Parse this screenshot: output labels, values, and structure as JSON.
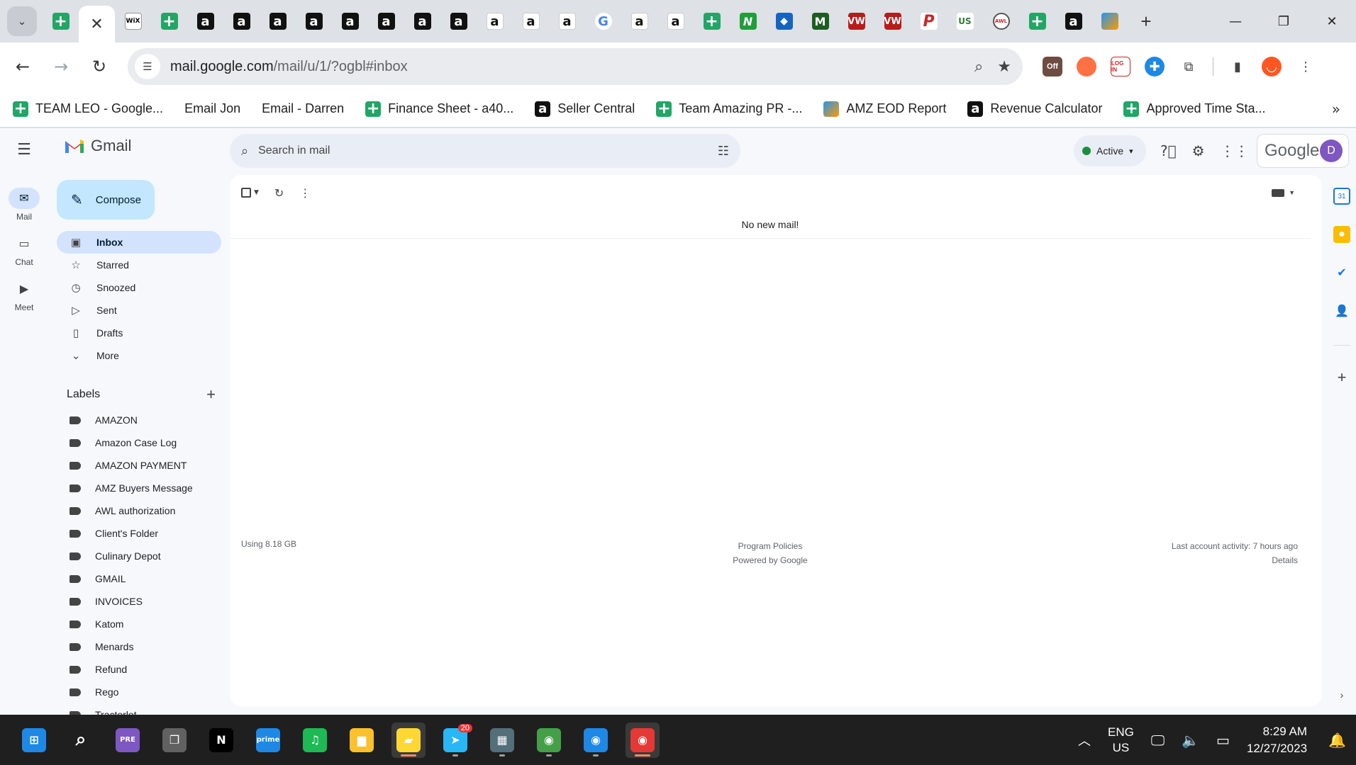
{
  "browser": {
    "tabs": [
      {
        "icon": "sheets-icon",
        "glyph": "+"
      },
      {
        "icon": "close-icon",
        "glyph": "✕",
        "active": true
      },
      {
        "icon": "wix-icon",
        "glyph": "WiX"
      },
      {
        "icon": "sheets-icon",
        "glyph": "+"
      },
      {
        "icon": "amazon-icon",
        "glyph": "a"
      },
      {
        "icon": "amazon-icon",
        "glyph": "a"
      },
      {
        "icon": "amazon-icon",
        "glyph": "a"
      },
      {
        "icon": "amazon-icon",
        "glyph": "a"
      },
      {
        "icon": "amazon-icon",
        "glyph": "a"
      },
      {
        "icon": "amazon-icon",
        "glyph": "a"
      },
      {
        "icon": "amazon-icon",
        "glyph": "a"
      },
      {
        "icon": "amazon-icon",
        "glyph": "a"
      },
      {
        "icon": "amazon-white-icon",
        "glyph": "a"
      },
      {
        "icon": "amazon-white-icon",
        "glyph": "a"
      },
      {
        "icon": "amazon-white-icon",
        "glyph": "a"
      },
      {
        "icon": "google-icon",
        "glyph": "G"
      },
      {
        "icon": "amazon-white-icon",
        "glyph": "a"
      },
      {
        "icon": "amazon-white-icon",
        "glyph": "a"
      },
      {
        "icon": "sheets-icon",
        "glyph": "+"
      },
      {
        "icon": "n-icon",
        "glyph": "N"
      },
      {
        "icon": "diamond-icon",
        "glyph": "◆"
      },
      {
        "icon": "m-icon",
        "glyph": "M"
      },
      {
        "icon": "vw-icon",
        "glyph": "VW"
      },
      {
        "icon": "vw-icon",
        "glyph": "VW"
      },
      {
        "icon": "p-icon",
        "glyph": "P"
      },
      {
        "icon": "usfoods-icon",
        "glyph": "US"
      },
      {
        "icon": "awl-icon",
        "glyph": "AWL"
      },
      {
        "icon": "sheets-icon",
        "glyph": "+"
      },
      {
        "icon": "amazon-icon",
        "glyph": "a"
      },
      {
        "icon": "pen-icon",
        "glyph": ""
      }
    ],
    "url_host": "mail.google.com",
    "url_path": "/mail/u/1/?ogbl#inbox",
    "bookmarks": [
      {
        "icon": "sheets",
        "label": "TEAM LEO - Google..."
      },
      {
        "icon": "gmail",
        "label": "Email Jon"
      },
      {
        "icon": "gmail",
        "label": "Email - Darren"
      },
      {
        "icon": "sheets",
        "label": "Finance Sheet - a40..."
      },
      {
        "icon": "amazon",
        "label": "Seller Central"
      },
      {
        "icon": "sheets",
        "label": "Team Amazing PR -..."
      },
      {
        "icon": "pen",
        "label": "AMZ EOD Report"
      },
      {
        "icon": "amazon",
        "label": "Revenue Calculator"
      },
      {
        "icon": "sheets",
        "label": "Approved Time Sta..."
      }
    ]
  },
  "gmail": {
    "logo_text": "Gmail",
    "rail": [
      {
        "label": "Mail",
        "icon": "mail-icon",
        "glyph": "✉",
        "active": true
      },
      {
        "label": "Chat",
        "icon": "chat-icon",
        "glyph": "▭"
      },
      {
        "label": "Meet",
        "icon": "meet-icon",
        "glyph": "▶"
      }
    ],
    "compose_label": "Compose",
    "nav": [
      {
        "label": "Inbox",
        "icon": "inbox-icon",
        "glyph": "▣",
        "active": true
      },
      {
        "label": "Starred",
        "icon": "star-icon",
        "glyph": "☆"
      },
      {
        "label": "Snoozed",
        "icon": "clock-icon",
        "glyph": "◷"
      },
      {
        "label": "Sent",
        "icon": "send-icon",
        "glyph": "▷"
      },
      {
        "label": "Drafts",
        "icon": "draft-icon",
        "glyph": "▯"
      },
      {
        "label": "More",
        "icon": "chevron-down-icon",
        "glyph": "⌄"
      }
    ],
    "labels_title": "Labels",
    "labels": [
      "AMAZON",
      "Amazon Case Log",
      "AMAZON PAYMENT",
      "AMZ Buyers Message",
      "AWL authorization",
      "Client's Folder",
      "Culinary Depot",
      "GMAIL",
      "INVOICES",
      "Katom",
      "Menards",
      "Refund",
      "Rego",
      "Tractorlot"
    ],
    "search_placeholder": "Search in mail",
    "status_label": "Active",
    "google_word": "Google",
    "avatar_letter": "D",
    "empty_message": "No new mail!",
    "storage": "Using 8.18 GB",
    "program_policies": "Program Policies",
    "powered_by": "Powered by Google",
    "last_activity": "Last account activity: 7 hours ago",
    "details": "Details"
  },
  "taskbar": {
    "apps": [
      {
        "name": "start-button",
        "glyph": "⊞",
        "bg": "#1e88e5"
      },
      {
        "name": "search-icon",
        "glyph": "⌕",
        "bg": "transparent"
      },
      {
        "name": "copilot-icon",
        "glyph": "PRE",
        "bg": "#7e57c2"
      },
      {
        "name": "task-view-icon",
        "glyph": "❐",
        "bg": "#616161"
      },
      {
        "name": "netflix-icon",
        "glyph": "N",
        "bg": "#000000"
      },
      {
        "name": "prime-video-icon",
        "glyph": "prime",
        "bg": "#1e88e5"
      },
      {
        "name": "spotify-icon",
        "glyph": "♫",
        "bg": "#1db954"
      },
      {
        "name": "file-explorer-icon",
        "glyph": "▆",
        "bg": "#fbc02d"
      },
      {
        "name": "sticky-notes-icon",
        "glyph": "▰",
        "bg": "#fdd835",
        "active": true
      },
      {
        "name": "telegram-icon",
        "glyph": "➤",
        "bg": "#29b6f6",
        "badge": "20"
      },
      {
        "name": "calculator-icon",
        "glyph": "▦",
        "bg": "#546e7a"
      },
      {
        "name": "chrome-icon",
        "glyph": "◉",
        "bg": "#43a047"
      },
      {
        "name": "chrome-icon",
        "glyph": "◉",
        "bg": "#1e88e5"
      },
      {
        "name": "chrome-icon",
        "glyph": "◉",
        "bg": "#e53935",
        "active": true
      }
    ],
    "lang_top": "ENG",
    "lang_bottom": "US",
    "time": "8:29 AM",
    "date": "12/27/2023"
  }
}
